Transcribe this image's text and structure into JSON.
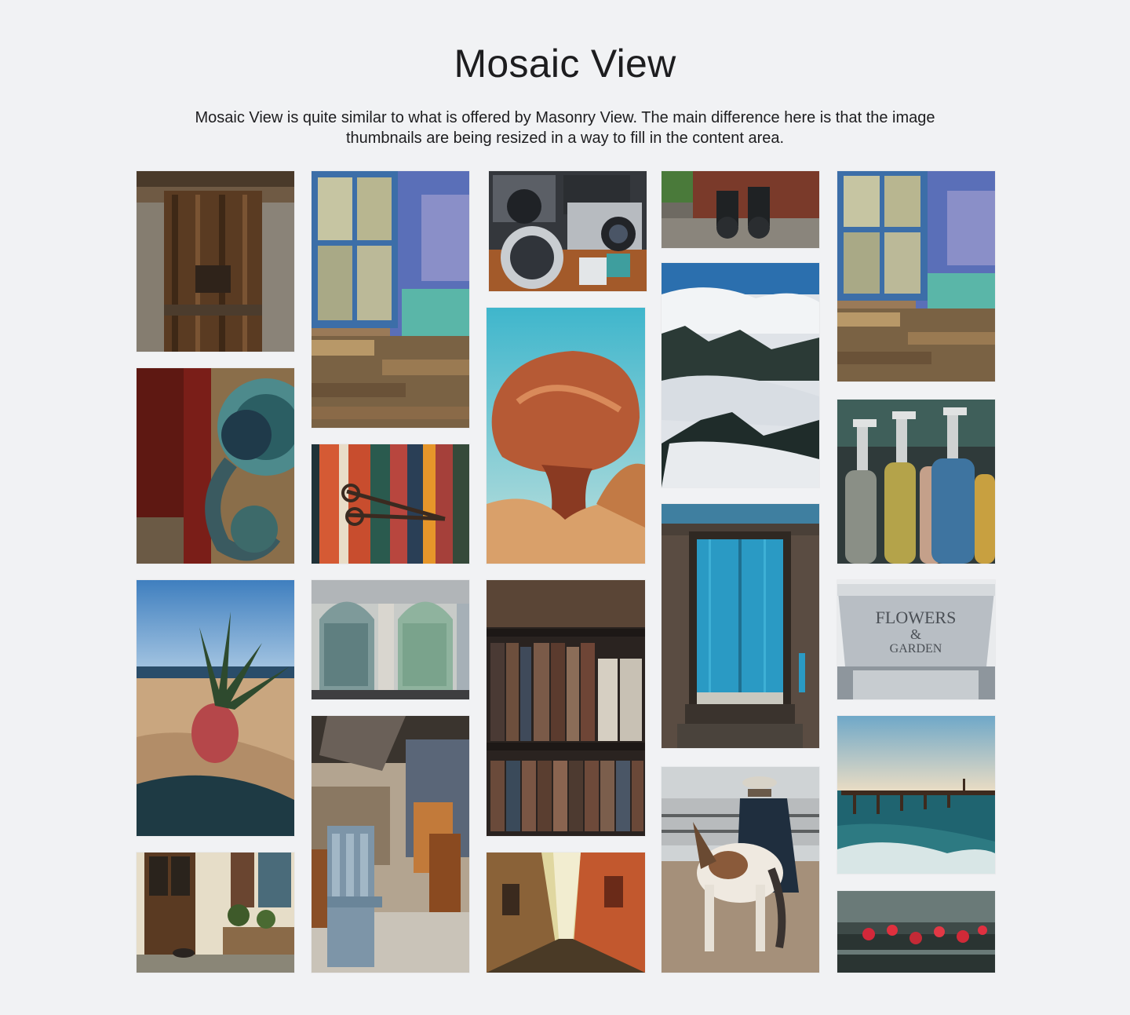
{
  "page": {
    "title": "Mosaic View",
    "description": "Mosaic View is quite similar to what is offered by Masonry View. The main difference here is that the image thumbnails are being resized in a way to fill in the content area."
  },
  "gallery": {
    "columns": [
      [
        "old-wooden-door",
        "door-knocker",
        "pineapple-beach",
        "house-entrance-cats"
      ],
      [
        "blue-window-wall",
        "scissors-striped-fabric",
        "green-arched-doors",
        "cafe-chairs"
      ],
      [
        "vintage-cameras",
        "red-rock-formation",
        "bookshelf",
        "narrow-street"
      ],
      [
        "binoculars",
        "misty-forest",
        "blue-door-cabin",
        "cowboy-horse"
      ],
      [
        "blue-window-wall-2",
        "glass-siphon-bottles",
        "flowers-garden-bucket",
        "pier-sea",
        "red-flowers-bicycle"
      ]
    ]
  },
  "colors": {
    "background": "#f1f2f4",
    "text": "#1d1d1f"
  }
}
